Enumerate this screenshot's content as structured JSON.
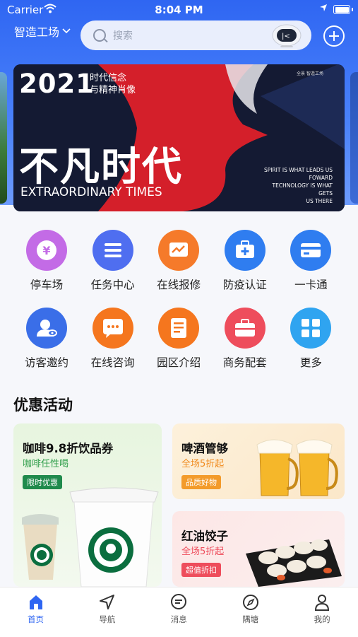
{
  "status": {
    "carrier": "Carrier",
    "time": "8:04 PM"
  },
  "header": {
    "location": "智造工场",
    "search_placeholder": "搜索"
  },
  "banner": {
    "year": "2021",
    "slogan": "时代信念\n与精神肖像",
    "headline": "不凡时代",
    "english": "EXTRAORDINARY TIMES",
    "right_text": "SPIRIT IS WHAT LEADS US\nFOWARD\nTECHNOLOGY IS WHAT GETS\nUS THERE",
    "logo_text": "全景 智造工场"
  },
  "services": [
    {
      "label": "停车场",
      "icon": "parking-yen-icon",
      "color": "#c36be6"
    },
    {
      "label": "任务中心",
      "icon": "list-icon",
      "color": "#4f6ef0"
    },
    {
      "label": "在线报修",
      "icon": "chart-screen-icon",
      "color": "#f57a2a"
    },
    {
      "label": "防疫认证",
      "icon": "medical-kit-icon",
      "color": "#2f7df0"
    },
    {
      "label": "一卡通",
      "icon": "card-icon",
      "color": "#2f7df0"
    },
    {
      "label": "访客邀约",
      "icon": "visitor-icon",
      "color": "#3a6ee8"
    },
    {
      "label": "在线咨询",
      "icon": "chat-bubble-icon",
      "color": "#f5761e"
    },
    {
      "label": "园区介绍",
      "icon": "document-icon",
      "color": "#f5761e"
    },
    {
      "label": "商务配套",
      "icon": "briefcase-icon",
      "color": "#ee4d5c"
    },
    {
      "label": "更多",
      "icon": "grid-icon",
      "color": "#2fa4f0"
    }
  ],
  "promotions": {
    "title": "优惠活动",
    "coffee": {
      "title": "咖啡9.8折饮品券",
      "subtitle": "咖啡任性喝",
      "tag": "限时优惠"
    },
    "beer": {
      "title": "啤酒管够",
      "subtitle": "全场5折起",
      "tag": "品质好物"
    },
    "dumpling": {
      "title": "红油饺子",
      "subtitle": "全场5折起",
      "tag": "超值折扣"
    }
  },
  "tabs": [
    {
      "label": "首页",
      "icon": "home-icon",
      "active": true
    },
    {
      "label": "导航",
      "icon": "navigation-icon"
    },
    {
      "label": "消息",
      "icon": "message-icon"
    },
    {
      "label": "隅塘",
      "icon": "compass-icon"
    },
    {
      "label": "我的",
      "icon": "user-icon"
    }
  ]
}
